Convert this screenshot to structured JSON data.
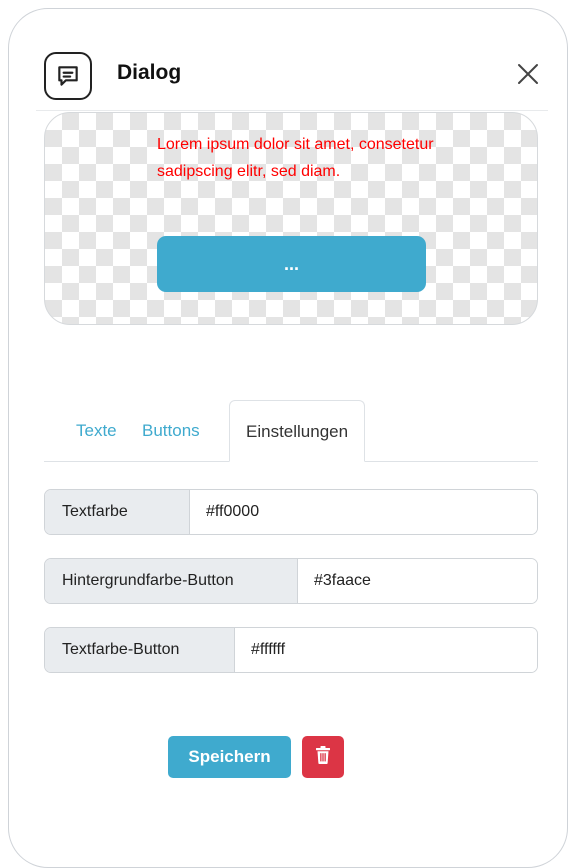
{
  "dialog": {
    "title": "Dialog",
    "icon": "message-square-icon",
    "close_icon": "close-icon"
  },
  "preview": {
    "text": "Lorem ipsum dolor sit amet, consetetur sadipscing elitr, sed diam.",
    "text_color": "#ff0000",
    "button_label": "...",
    "button_bg": "#3faace",
    "button_text_color": "#ffffff"
  },
  "tabs": [
    {
      "label": "Texte",
      "active": false
    },
    {
      "label": "Buttons",
      "active": false
    },
    {
      "label": "Einstellungen",
      "active": true
    }
  ],
  "settings": [
    {
      "label": "Textfarbe",
      "value": "#ff0000"
    },
    {
      "label": "Hintergrundfarbe-Button",
      "value": "#3faace"
    },
    {
      "label": "Textfarbe-Button",
      "value": "#ffffff"
    }
  ],
  "actions": {
    "save_label": "Speichern",
    "delete_icon": "trash-icon"
  },
  "colors": {
    "accent": "#3faace",
    "danger": "#dc3545"
  }
}
